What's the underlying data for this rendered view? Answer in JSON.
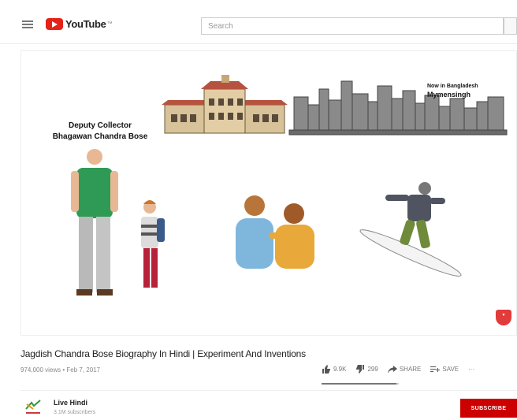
{
  "header": {
    "logo_text": "YouTube",
    "logo_tm": "™",
    "search_placeholder": "Search"
  },
  "video": {
    "caption_left_line1": "Deputy Collector",
    "caption_left_line2": "Bhagawan Chandra Bose",
    "caption_right_line1": "Now in Bangladesh",
    "caption_right_line2": "Mymensingh",
    "title": "Jagdish Chandra Bose Biography In Hindi | Experiment And Inventions",
    "meta": "974,000 views • Feb 7, 2017",
    "likes": "9.9K",
    "dislikes": "299",
    "share_label": "SHARE",
    "save_label": "SAVE",
    "more_label": "···",
    "like_ratio": 0.97
  },
  "channel": {
    "name": "Live Hindi",
    "subscribers": "3.1M subscribers",
    "subscribe_label": "SUBSCRIBE"
  },
  "colors": {
    "brand_red": "#e62117",
    "subscribe_red": "#cc0000"
  }
}
